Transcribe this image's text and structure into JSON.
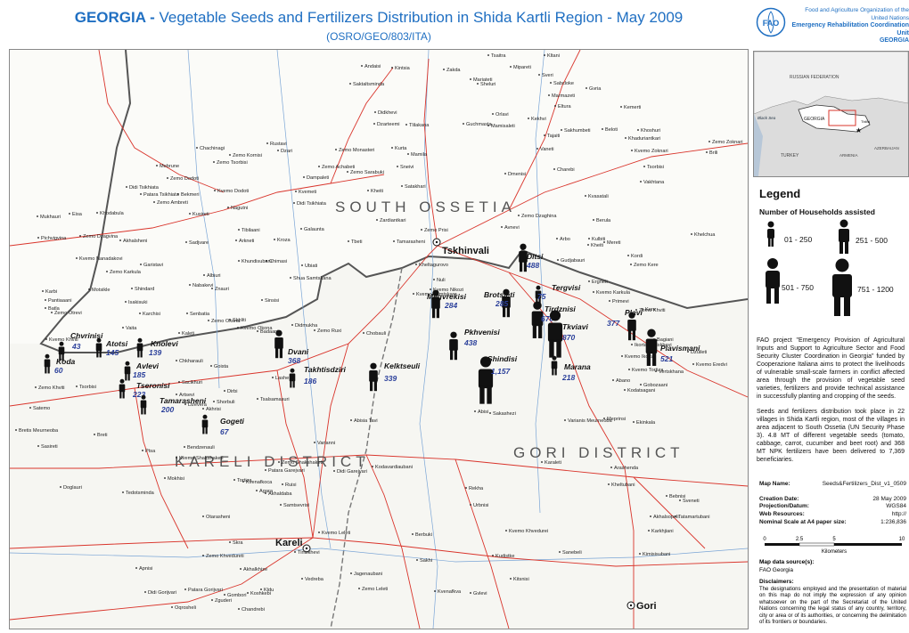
{
  "header": {
    "title_country": "GEORGIA -",
    "title_rest": "Vegetable Seeds and Fertilizers Distribution in Shida Kartli Region - May 2009",
    "subtitle": "(OSRO/GEO/803/ITA)",
    "org_line1": "Food and Agriculture Organization of the United Nations",
    "org_line2": "Emergency Rehabilitation Coordination Unit",
    "org_line3": "GEORGIA",
    "logo_text": "FAO"
  },
  "colors": {
    "title_blue": "#1f6fc2",
    "road_red": "#d9342b",
    "boundary": "#555555",
    "ossetia_fill": "#ffffff",
    "count_blue": "#2a3f9a"
  },
  "map": {
    "districts": [
      "SOUTH OSSETIA",
      "KARELI DISTRICT",
      "GORI DISTRICT"
    ],
    "cities": [
      "Tskhinvali",
      "Kareli",
      "Gori"
    ],
    "sites": [
      {
        "name": "Chvrinisi",
        "count": "43"
      },
      {
        "name": "Atotsi",
        "count": "145"
      },
      {
        "name": "Knolevi",
        "count": "139"
      },
      {
        "name": "Koda",
        "count": "60"
      },
      {
        "name": "Avlevi",
        "count": "185"
      },
      {
        "name": "Tseronisi",
        "count": "223"
      },
      {
        "name": "Tamarasheni",
        "count": "200"
      },
      {
        "name": "Dvani",
        "count": "368"
      },
      {
        "name": "Takhtisdziri",
        "count": "186"
      },
      {
        "name": "Gogeti",
        "count": "67"
      },
      {
        "name": "Kelktseuli",
        "count": "339"
      },
      {
        "name": "Pkhvenisi",
        "count": "438"
      },
      {
        "name": "Shindisi",
        "count": "1,157"
      },
      {
        "name": "Ditsi",
        "count": "488"
      },
      {
        "name": "Megvrekisi",
        "count": "284"
      },
      {
        "name": "Brotsleti",
        "count": "285"
      },
      {
        "name": "Tergvisi",
        "count": "75"
      },
      {
        "name": "Tirdznisi",
        "count": "670"
      },
      {
        "name": "Tkviavi",
        "count": "870"
      },
      {
        "name": "Plavi",
        "count": "377"
      },
      {
        "name": "Plavismani",
        "count": "521"
      },
      {
        "name": "Marana",
        "count": "218"
      }
    ],
    "places": [
      "Tsaitra",
      "Kltani",
      "Andaisi",
      "Kintsia",
      "Zakda",
      "Mipareti",
      "Mariateti",
      "Sveri",
      "Saktaltsminda",
      "Sheluri",
      "Sabcloke",
      "Gvria",
      "Marmazeti",
      "Eltura",
      "Kemerti",
      "Didkhevi",
      "Orlavi",
      "Kekhvi",
      "Dzarteemi",
      "Tlilakana",
      "Guchmasta",
      "Mamisaleti",
      "Sakhumbeti",
      "Beloti",
      "Tajaiti",
      "Khoshuri",
      "Khaduriantkari",
      "Zemo Zoknari",
      "Rustavi",
      "Chachinagi",
      "Dzari",
      "Zemo Monasteri",
      "Kurta",
      "Mamila",
      "Vaneti",
      "Kvemo Zoknari",
      "Brili",
      "Zemo Kornisi",
      "Zemo Tsorbisi",
      "Mebrune",
      "Zemo Achabeti",
      "Sneivi",
      "Tsorbisi",
      "Zemo Dodoti",
      "Dampaleti",
      "Zemo Sarabuki",
      "Dmenisi",
      "Charebi",
      "Vakhtana",
      "Didi Tsikhiata",
      "Patara Tsikhiata",
      "Bekmeri",
      "Kvemo Dodoti",
      "Kvemeti",
      "Kheiti",
      "Satakhari",
      "Kvasatali",
      "Didi Tsikhiata",
      "Zemo Ambreti",
      "Nagutni",
      "Mukhauri",
      "Eisa",
      "Khodabula",
      "Kusireti",
      "Zardiantkari",
      "Berula",
      "Zemo Dzaghina",
      "Tibilaani",
      "Galaunta",
      "Zemo Prisi",
      "Avnevi",
      "Pichvigvina",
      "Zemo Dzagvina",
      "Akhalsheni",
      "Sadjvare",
      "Arkneti",
      "Kroza",
      "Tbeti",
      "Tamarasheni",
      "Arbo",
      "Kheiti",
      "Mereti",
      "Kulbiti",
      "Khelchua",
      "Kvemo Nanadakovi",
      "Garistavi",
      "Khundisubani",
      "Chimasi",
      "Ubiati",
      "Kheltagurovo",
      "Gudjabauri",
      "Kordi",
      "Zemo Kere",
      "Zemo Karkula",
      "Albiuri",
      "Shua Samtskana",
      "Nuli",
      "Ergneti",
      "Karbi",
      "Motsikle",
      "Shindard",
      "Nabakevi",
      "Znauri",
      "Kvemo Samtskaro",
      "Kvemo Nikozi",
      "Kvemo Karkula",
      "Pantiaaani",
      "Batla",
      "Isakisuki",
      "Sinsisi",
      "Primevi",
      "Zemo Khviti",
      "Kere",
      "Zemo Otrevi",
      "Karchisi",
      "Senbatia",
      "Zemo Okona",
      "Skhliti",
      "Didmukha",
      "Vaita",
      "Kaleti",
      "Kvemo Okona",
      "Badaani",
      "Zemo Ruxi",
      "Chobauli",
      "Kvemo Khviti",
      "Chkharauli",
      "Ikorta",
      "Tiniskhevi",
      "Kvemo Ikorta",
      "Bagiani",
      "Dzuileti",
      "Artsevi",
      "Goista",
      "Kvemo Tortiza",
      "Vertskhana",
      "Kvemo Eredvi",
      "Abano",
      "Kodatsagani",
      "Gobozaani",
      "Zemo Khviti",
      "Tsorbisi",
      "Sacikhuri",
      "Lashe",
      "Dirbi",
      "Shorbuli",
      "Dzevera",
      "Satemo",
      "Akhrisi",
      "Tsalsamasuri",
      "Abisia Tavi",
      "Abisi",
      "Sakashezi",
      "Varianis Meurneoba",
      "Meprinsi",
      "Ekinkala",
      "Bretis Meurneoba",
      "Breti",
      "Ptsa",
      "Bendzenauli",
      "Sasireti",
      "Varianni",
      "Patara Garejvari",
      "Zemo Shakshaketi",
      "Kvemo Shakshaketi",
      "Didi Garejvari",
      "Kodavardiaubani",
      "Karaleti",
      "Arashenda",
      "Mokhisi",
      "Tortiza",
      "Kvenafkoca",
      "Doglauri",
      "Akhaldaba",
      "Kheltubani",
      "Agara",
      "Ruisi",
      "Rekha",
      "Bebnisi",
      "Tedotsminda",
      "Sveneti",
      "Samtsevrisi",
      "Urbnisi",
      "Otarasheni",
      "Berbuki",
      "Akhalsopeli",
      "Tatamartubani",
      "Karkhjiani",
      "Kvemo Khvedurei",
      "Kvemo Leleti",
      "Skra",
      "Tiniskhevi",
      "Sakhi",
      "Kudistke",
      "Sanebeli",
      "Kimisisubani",
      "Apnisi",
      "Zemo Khvedureti",
      "Akhalkhize",
      "Jagenaubani",
      "Vedreba",
      "Kitsnisi",
      "Kldu",
      "Zemo Leleti",
      "Kvenafkva",
      "Gvlevi",
      "Patara Gorijvari",
      "Didi Gorijvari",
      "Oqrosheli",
      "Gombori",
      "Zguderi",
      "Chandrebi",
      "Koshkebi"
    ]
  },
  "legend": {
    "title": "Legend",
    "subtitle": "Number of Households  assisted",
    "ranges": [
      "01 - 250",
      "251 - 500",
      "501 - 750",
      "751 - 1200"
    ]
  },
  "project_text": "FAO project \"Emergency Provision of Agricultural Inputs and Support to Agriculture Sector and Food Security Cluster Coordination in Georgia\" funded by Cooperazione Italiana aims to protect the livelihoods of vulnerable small-scale farmers in conflict affected area through the provision of vegetable seed varieties, fertilizers and provide technical assistance in successfully planting and cropping of the seeds.",
  "distribution_text": "Seeds and fertilizers distribution took place in 22 villages in Shida Kartli region, most of the villages in area adjacent to South Ossetia (UN Security Phase 3). 4.8 MT of different vegetable seeds (tomato, cabbage, carrot, cucumber and beet root) and 368 MT NPK fertilizers have been delivered to 7,369 beneficiaries.",
  "metadata": {
    "map_name_label": "Map Name:",
    "map_name": "Seeds&Fertilizers_Dist_v1_0509",
    "creation_date_label": "Creation Date:",
    "creation_date": "28 May 2009",
    "projection_label": "Projection/Datum:",
    "projection": "WGS84",
    "web_label": "Web Resources:",
    "web": "http://",
    "scale_label": "Nominal Scale at A4 paper size:",
    "scale": "1:236,836"
  },
  "scale_bar": {
    "ticks": [
      "0",
      "2.5",
      "5",
      "10"
    ],
    "unit": "Kilometers"
  },
  "source": {
    "label": "Map data source(s):",
    "value": "FAO Georgia"
  },
  "disclaimer": {
    "label": "Disclaimers:",
    "text": "The designations employed and the presentation of material on this map do not imply the expression of any opinion whatsoever on the part of the Secretariat of the United Nations concerning the legal status of any country, territory, city or area or of its authorities, or concerning the delimitation of its frontiers or boundaries."
  },
  "inset": {
    "labels": [
      "RUSSIAN FEDERATION",
      "GEORGIA",
      "Black Sea",
      "TURKEY",
      "ARMENIA",
      "AZERBAIJAN",
      "Tbilisi"
    ]
  }
}
